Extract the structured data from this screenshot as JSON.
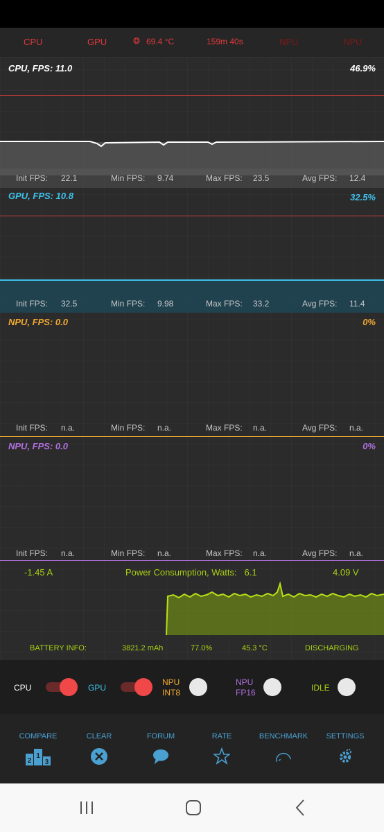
{
  "topbar": {
    "cpu": "CPU",
    "gpu": "GPU",
    "temperature": "69.4 °C",
    "elapsed": "159m 40s",
    "npu1": "NPU",
    "npu2": "NPU"
  },
  "panels": {
    "cpu": {
      "title": "CPU, FPS:",
      "fps": "11.0",
      "load": "46.9%",
      "init_label": "Init FPS:",
      "init": "22.1",
      "min_label": "Min FPS:",
      "min": "9.74",
      "max_label": "Max FPS:",
      "max": "23.5",
      "avg_label": "Avg FPS:",
      "avg": "12.4"
    },
    "gpu": {
      "title": "GPU, FPS:",
      "fps": "10.8",
      "load": "32.5%",
      "init_label": "Init FPS:",
      "init": "32.5",
      "min_label": "Min FPS:",
      "min": "9.98",
      "max_label": "Max FPS:",
      "max": "33.2",
      "avg_label": "Avg FPS:",
      "avg": "11.4"
    },
    "npu_int8": {
      "title": "NPU, FPS:",
      "fps": "0.0",
      "load": "0%",
      "init_label": "Init FPS:",
      "init": "n.a.",
      "min_label": "Min FPS:",
      "min": "n.a.",
      "max_label": "Max FPS:",
      "max": "n.a.",
      "avg_label": "Avg FPS:",
      "avg": "n.a."
    },
    "npu_fp16": {
      "title": "NPU, FPS:",
      "fps": "0.0",
      "load": "0%",
      "init_label": "Init FPS:",
      "init": "n.a.",
      "min_label": "Min FPS:",
      "min": "n.a.",
      "max_label": "Max FPS:",
      "max": "n.a.",
      "avg_label": "Avg FPS:",
      "avg": "n.a."
    }
  },
  "power": {
    "current": "-1.45 A",
    "label": "Power Consumption, Watts:",
    "watts": "6.1",
    "voltage": "4.09 V"
  },
  "battery": {
    "label": "BATTERY INFO:",
    "capacity": "3821.2 mAh",
    "level": "77.0%",
    "temperature": "45.3 °C",
    "status": "DISCHARGING"
  },
  "toggles": {
    "cpu": {
      "label": "CPU",
      "on": true
    },
    "gpu": {
      "label": "GPU",
      "on": true
    },
    "npu_int8": {
      "line1": "NPU",
      "line2": "INT8",
      "on": false
    },
    "npu_fp16": {
      "line1": "NPU",
      "line2": "FP16",
      "on": false
    },
    "idle": {
      "label": "IDLE",
      "on": false
    }
  },
  "nav": {
    "compare": "COMPARE",
    "clear": "CLEAR",
    "forum": "FORUM",
    "rate": "RATE",
    "benchmark": "BENCHMARK",
    "settings": "SETTINGS",
    "compare_badges": [
      "2",
      "1",
      "3"
    ]
  },
  "colors": {
    "red": "#e0393b",
    "cpu_line": "#ffffff",
    "gpu_line": "#3fc0ea",
    "npu_int8": "#f0a830",
    "npu_fp16": "#b070e0",
    "power": "#a8d014",
    "nav_blue": "#4aa0d0"
  }
}
